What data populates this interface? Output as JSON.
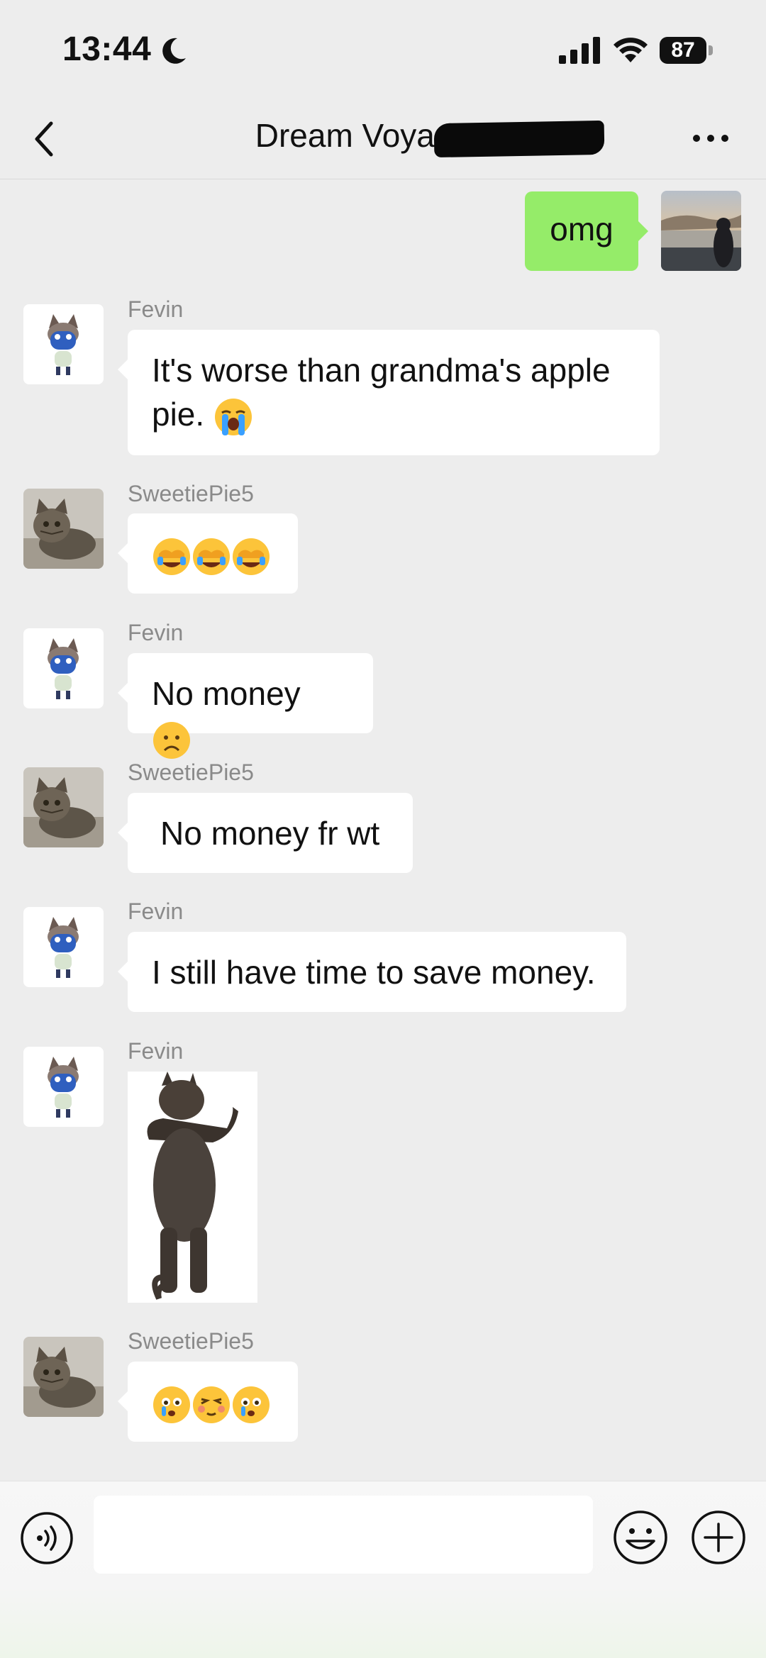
{
  "status_bar": {
    "time": "13:44",
    "battery": "87"
  },
  "nav": {
    "title": "Dream Voyage(..)"
  },
  "messages": [
    {
      "sender": "me",
      "text": "omg"
    },
    {
      "sender": "Fevin",
      "text_line1": "It's worse than grandma's apple",
      "text_line2": "pie."
    },
    {
      "sender": "SweetiePie5",
      "content": "three crying-laughing emojis"
    },
    {
      "sender": "Fevin",
      "text": "No money"
    },
    {
      "sender": "SweetiePie5",
      "text": "No money fr wt"
    },
    {
      "sender": "Fevin",
      "text": "I still have time to save money."
    },
    {
      "sender": "Fevin",
      "content": "dancing cat sticker"
    },
    {
      "sender": "SweetiePie5",
      "content": "emojis"
    }
  ],
  "input": {
    "placeholder": ""
  },
  "icons": [
    "moon-icon",
    "signal-icon",
    "wifi-icon",
    "battery-icon",
    "back-icon",
    "more-icon",
    "voice-icon",
    "emoji-icon",
    "plus-icon"
  ],
  "colors": {
    "background": "#ededed",
    "my_bubble": "#95ec69",
    "their_bubble": "#ffffff",
    "name_text": "#8a8a8a"
  }
}
